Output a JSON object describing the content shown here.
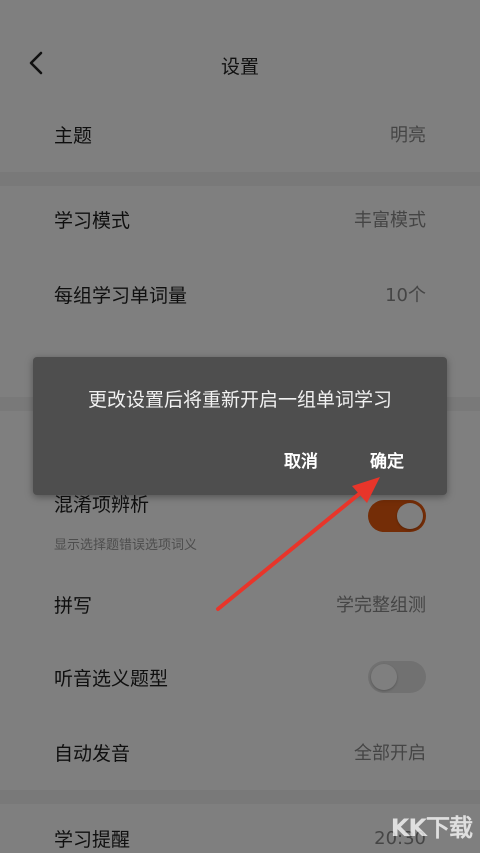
{
  "header": {
    "title": "设置"
  },
  "settings": {
    "theme": {
      "label": "主题",
      "value": "明亮"
    },
    "study_mode": {
      "label": "学习模式",
      "value": "丰富模式"
    },
    "words_per_group": {
      "label": "每组学习单词量",
      "value": "10个"
    },
    "confusion_analysis": {
      "label": "混淆项辨析",
      "sub": "显示选择题错误选项词义",
      "enabled": true
    },
    "spelling": {
      "label": "拼写",
      "value": "学完整组测"
    },
    "listen_choose": {
      "label": "听音选义题型",
      "enabled": false
    },
    "auto_pronounce": {
      "label": "自动发音",
      "value": "全部开启"
    },
    "study_reminder": {
      "label": "学习提醒",
      "value": "20:30"
    }
  },
  "dialog": {
    "message": "更改设置后将重新开启一组单词学习",
    "cancel_label": "取消",
    "confirm_label": "确定"
  },
  "watermark": "KK下载",
  "colors": {
    "accent": "#e85a0e",
    "annotation_arrow": "#e8352a",
    "dialog_bg": "#4e4e4e"
  }
}
